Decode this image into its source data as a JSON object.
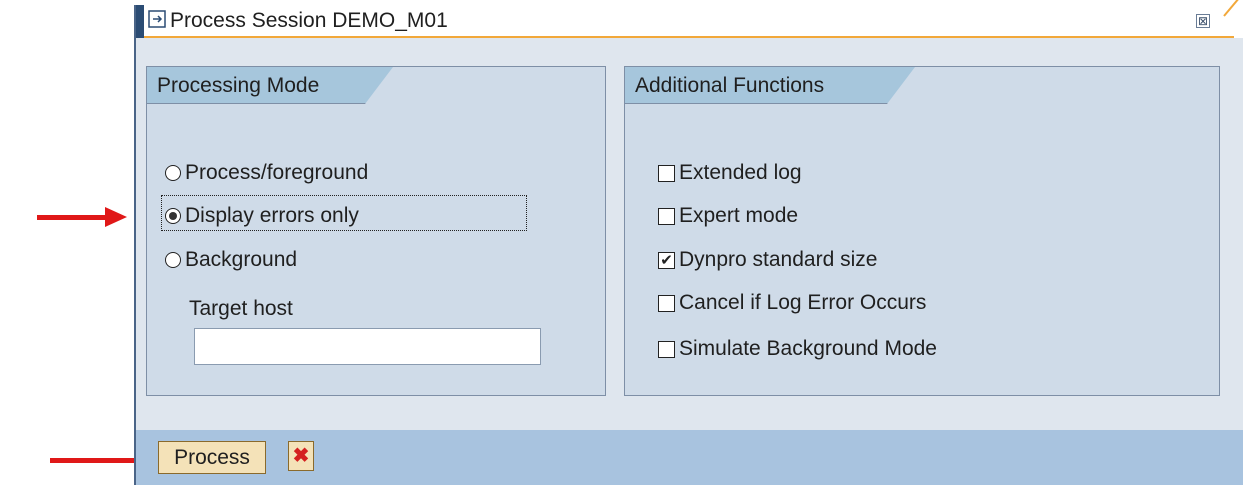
{
  "window": {
    "title": "Process Session DEMO_M01",
    "close_symbol": "⊠",
    "accent_color": "#f2a83a"
  },
  "processing_mode": {
    "heading": "Processing Mode",
    "options": [
      {
        "label": "Process/foreground",
        "selected": false
      },
      {
        "label": "Display errors only",
        "selected": true
      },
      {
        "label": "Background",
        "selected": false
      }
    ],
    "target_host_label": "Target host",
    "target_host_value": ""
  },
  "additional_functions": {
    "heading": "Additional Functions",
    "options": [
      {
        "label": "Extended log",
        "checked": false
      },
      {
        "label": "Expert mode",
        "checked": false
      },
      {
        "label": "Dynpro standard size",
        "checked": true
      },
      {
        "label": "Cancel if Log Error Occurs",
        "checked": false
      },
      {
        "label": "Simulate Background Mode",
        "checked": false
      }
    ]
  },
  "toolbar": {
    "process_label": "Process",
    "cancel_symbol": "✖"
  },
  "icons": [
    "session-icon",
    "close-icon",
    "cancel-icon",
    "annotation-arrow"
  ]
}
